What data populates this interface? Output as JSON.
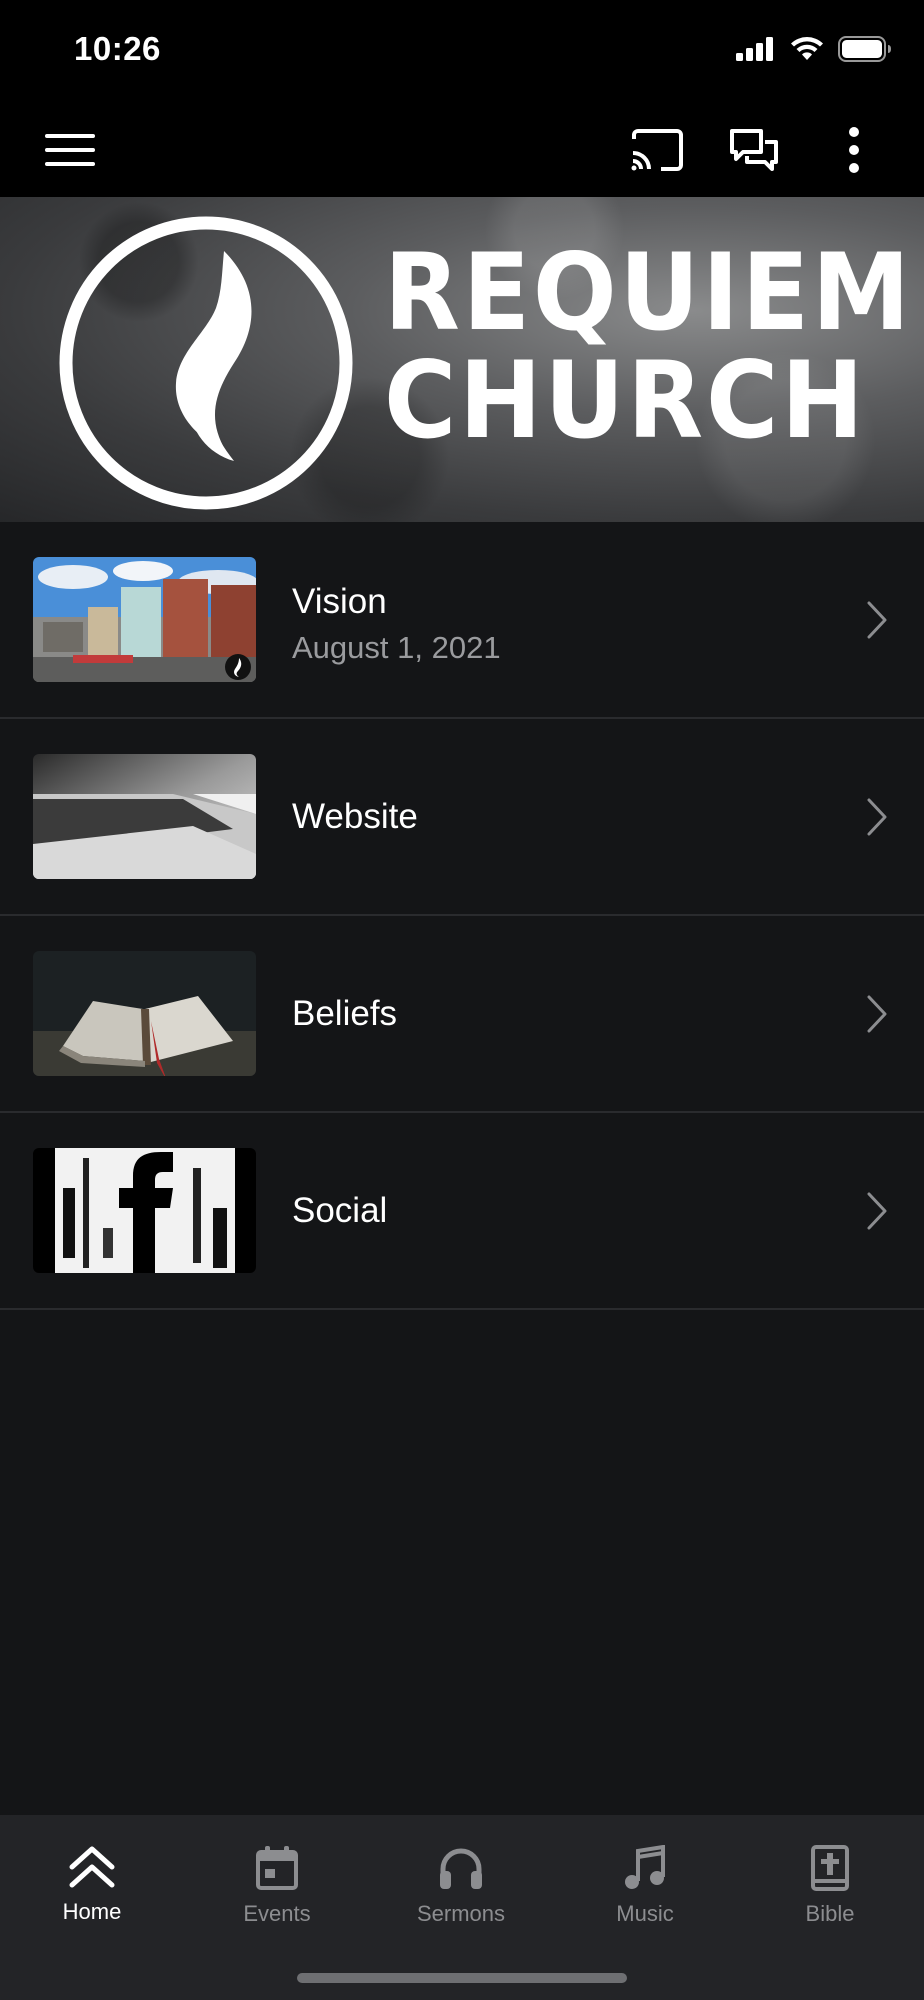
{
  "status_bar": {
    "time": "10:26"
  },
  "banner": {
    "line1": "REQUIEM",
    "line2": "CHURCH"
  },
  "list": [
    {
      "title": "Vision",
      "subtitle": "August 1, 2021",
      "thumb": "town-street"
    },
    {
      "title": "Website",
      "subtitle": "",
      "thumb": "laptop"
    },
    {
      "title": "Beliefs",
      "subtitle": "",
      "thumb": "open-bible"
    },
    {
      "title": "Social",
      "subtitle": "",
      "thumb": "facebook-grunge"
    }
  ],
  "tabs": [
    {
      "label": "Home",
      "icon": "double-chevron-up-icon",
      "active": true
    },
    {
      "label": "Events",
      "icon": "calendar-icon",
      "active": false
    },
    {
      "label": "Sermons",
      "icon": "headphones-icon",
      "active": false
    },
    {
      "label": "Music",
      "icon": "music-note-icon",
      "active": false
    },
    {
      "label": "Bible",
      "icon": "bible-icon",
      "active": false
    }
  ],
  "colors": {
    "background": "#141517",
    "bar": "#000000",
    "tabbar": "#232427",
    "muted_text": "#8c8d90"
  }
}
